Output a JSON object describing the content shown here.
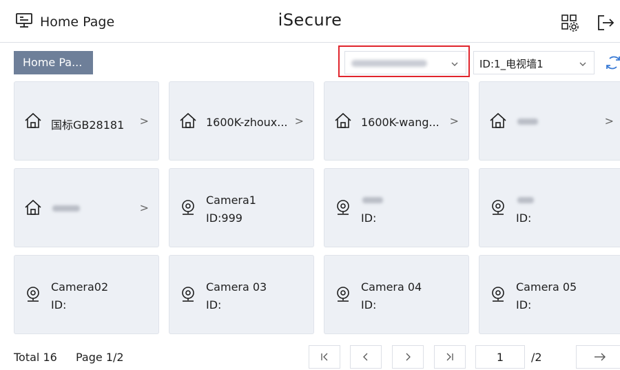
{
  "header": {
    "home_label": "Home Page",
    "app_title": "iSecure",
    "icons": [
      "monitor-icon",
      "layout-settings-icon",
      "logout-icon"
    ]
  },
  "toolbar": {
    "breadcrumb": "Home Pa...",
    "server_select": {
      "value": "",
      "note_blurred": true
    },
    "wall_select": {
      "value": "ID:1_电视墙1"
    },
    "highlight_color": "#e0242c"
  },
  "cards": [
    {
      "type": "area",
      "title": "国标GB28181"
    },
    {
      "type": "area",
      "title": "1600K-zhoux..."
    },
    {
      "type": "area",
      "title": "1600K-wang..."
    },
    {
      "type": "area",
      "title": ""
    },
    {
      "type": "area",
      "title": ""
    },
    {
      "type": "camera",
      "name": "Camera1",
      "id": "ID:999"
    },
    {
      "type": "camera",
      "name": "",
      "id": "ID:"
    },
    {
      "type": "camera",
      "name": "",
      "id": "ID:"
    },
    {
      "type": "camera",
      "name": "Camera02",
      "id": "ID:"
    },
    {
      "type": "camera",
      "name": "Camera 03",
      "id": "ID:"
    },
    {
      "type": "camera",
      "name": "Camera 04",
      "id": "ID:"
    },
    {
      "type": "camera",
      "name": "Camera 05",
      "id": "ID:"
    }
  ],
  "pagination": {
    "total_label": "Total 16",
    "page_label": "Page 1/2",
    "current_page": "1",
    "total_pages_label": "/2",
    "buttons": {
      "first": "|<",
      "prev": "<",
      "next": ">",
      "last": ">|",
      "go": "→"
    }
  },
  "colors": {
    "card_bg": "#edf0f5",
    "breadcrumb_bg": "#6e7f99"
  }
}
